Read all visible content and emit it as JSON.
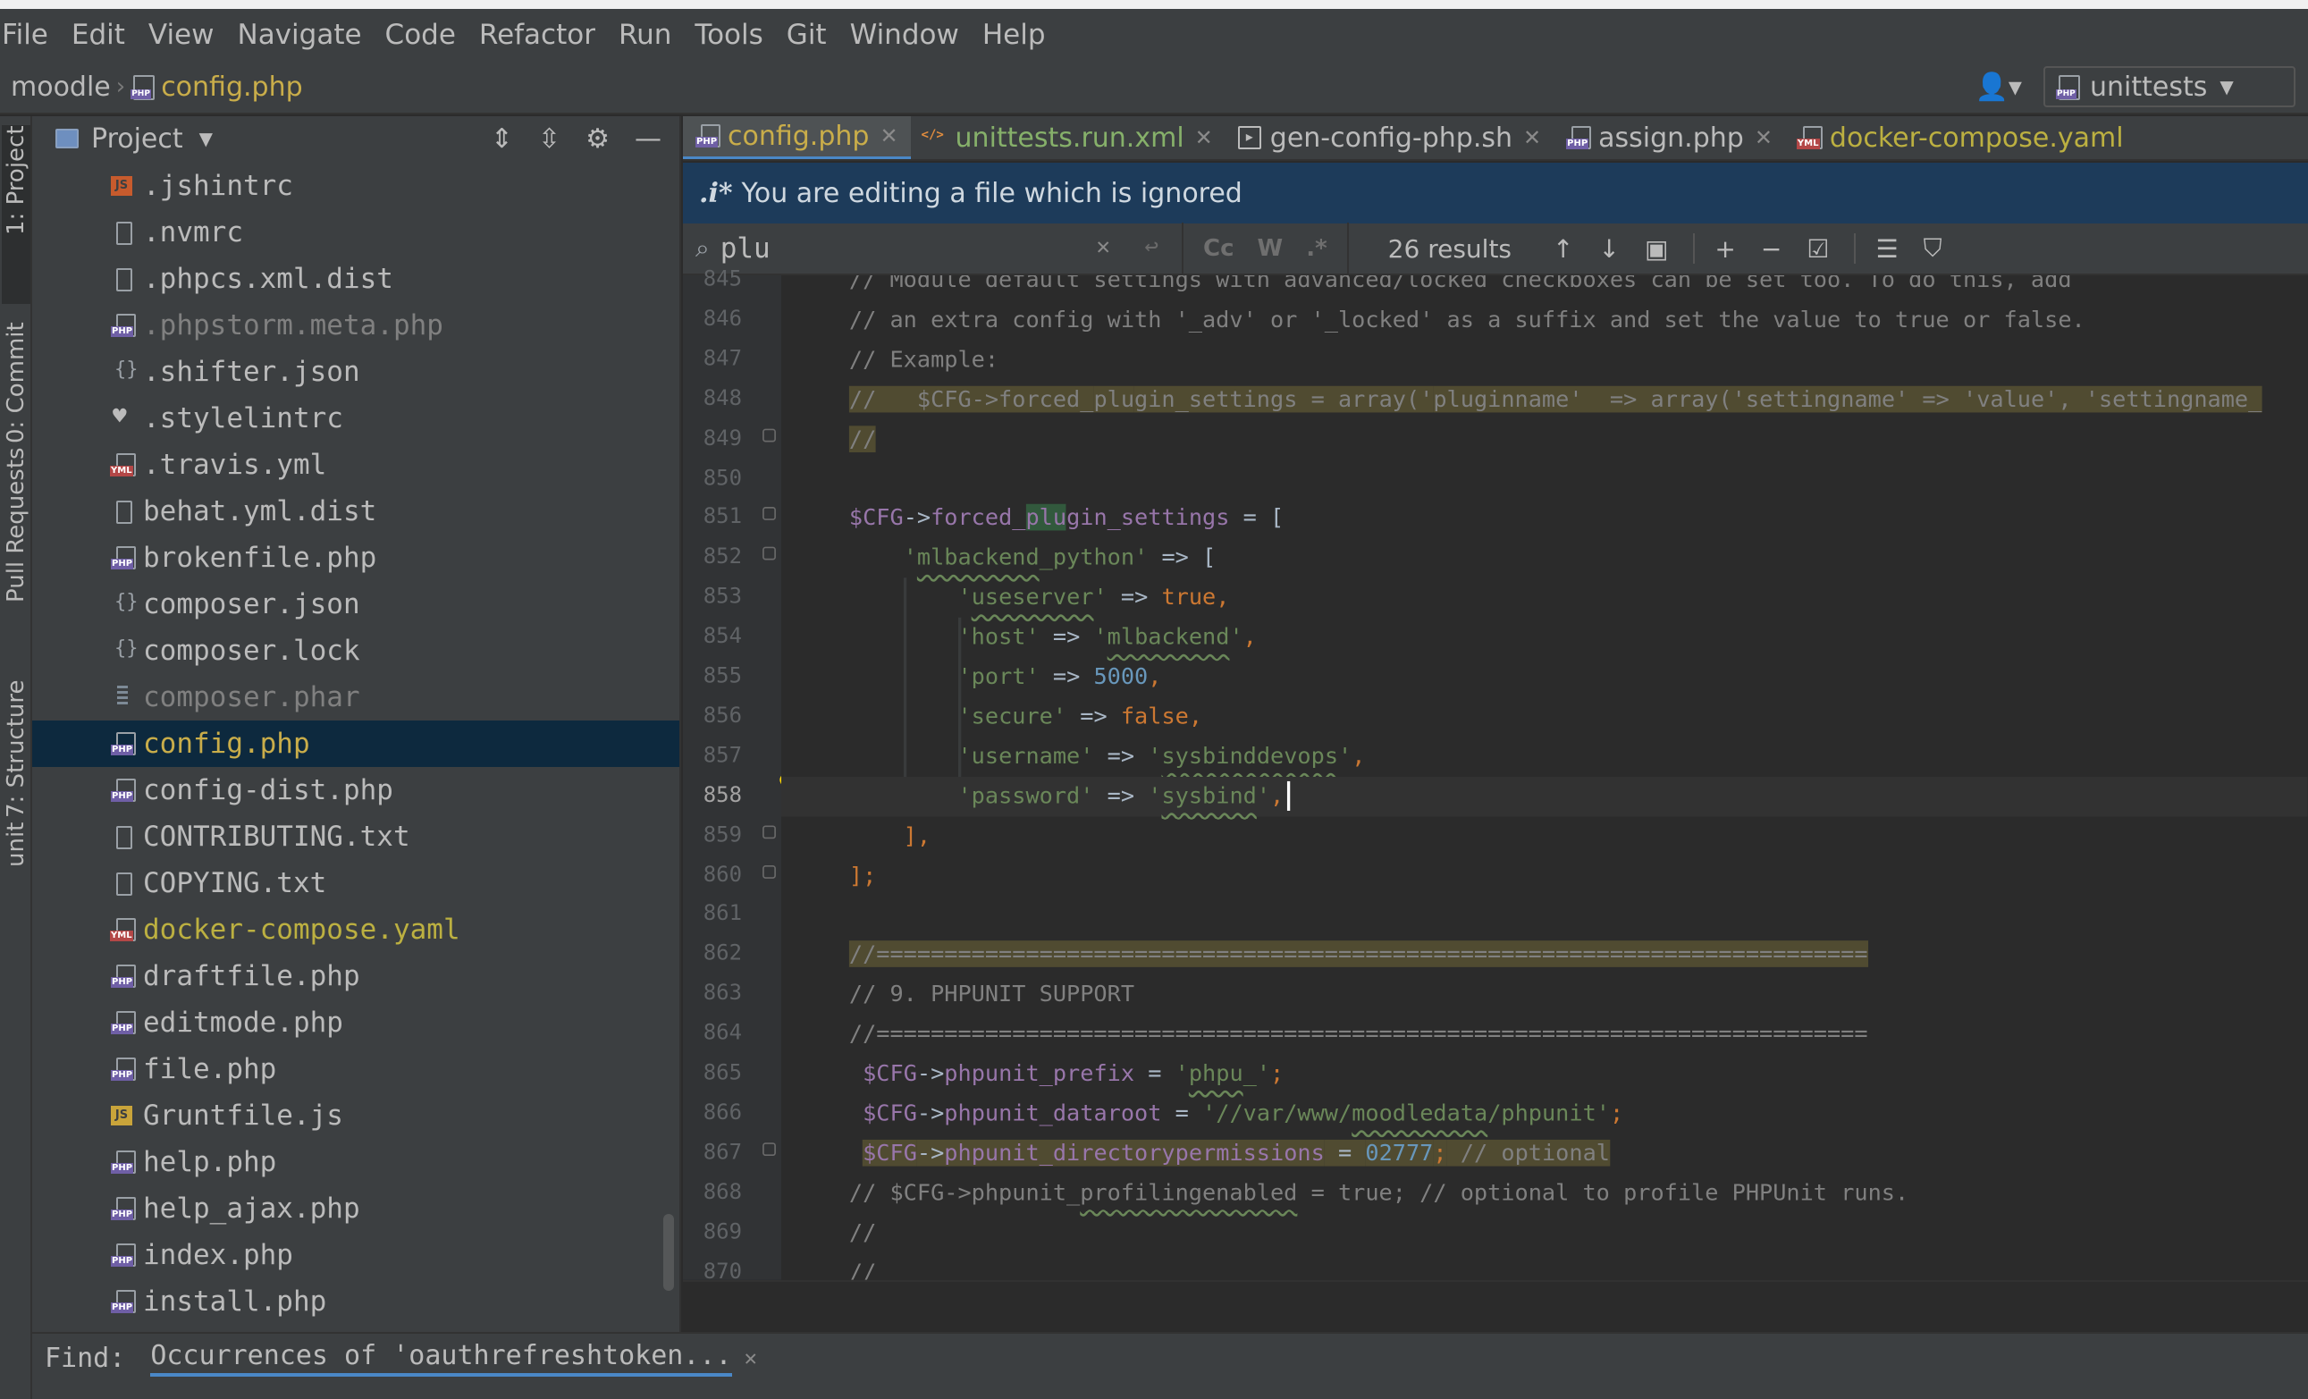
{
  "menu": [
    "File",
    "Edit",
    "View",
    "Navigate",
    "Code",
    "Refactor",
    "Run",
    "Tools",
    "Git",
    "Window",
    "Help"
  ],
  "breadcrumb": {
    "root": "moodle",
    "file": "config.php"
  },
  "run_config": {
    "label": "unittests"
  },
  "tool_windows": {
    "project": "1: Project",
    "commit": "0: Commit",
    "pull_requests": "Pull Requests",
    "structure": "7: Structure",
    "bottom": "unit"
  },
  "project_panel": {
    "title": "Project",
    "files": [
      {
        "name": ".jshintrc",
        "icon": "js-icon",
        "style": "normal"
      },
      {
        "name": ".nvmrc",
        "icon": "text-file-icon",
        "style": "normal"
      },
      {
        "name": ".phpcs.xml.dist",
        "icon": "text-file-icon",
        "style": "normal"
      },
      {
        "name": ".phpstorm.meta.php",
        "icon": "php-file-icon",
        "style": "dim"
      },
      {
        "name": ".shifter.json",
        "icon": "json-file-icon",
        "style": "normal"
      },
      {
        "name": ".stylelintrc",
        "icon": "stylelint-icon",
        "style": "normal"
      },
      {
        "name": ".travis.yml",
        "icon": "yml-file-icon",
        "style": "normal"
      },
      {
        "name": "behat.yml.dist",
        "icon": "text-file-icon",
        "style": "normal"
      },
      {
        "name": "brokenfile.php",
        "icon": "php-file-icon",
        "style": "normal"
      },
      {
        "name": "composer.json",
        "icon": "json-file-icon",
        "style": "normal"
      },
      {
        "name": "composer.lock",
        "icon": "json-file-icon",
        "style": "normal"
      },
      {
        "name": "composer.phar",
        "icon": "archive-file-icon",
        "style": "dim"
      },
      {
        "name": "config.php",
        "icon": "php-file-icon",
        "style": "selected"
      },
      {
        "name": "config-dist.php",
        "icon": "php-file-icon",
        "style": "normal"
      },
      {
        "name": "CONTRIBUTING.txt",
        "icon": "text-file-icon",
        "style": "normal"
      },
      {
        "name": "COPYING.txt",
        "icon": "text-file-icon",
        "style": "normal"
      },
      {
        "name": "docker-compose.yaml",
        "icon": "yml-file-icon",
        "style": "yaml"
      },
      {
        "name": "draftfile.php",
        "icon": "php-file-icon",
        "style": "normal"
      },
      {
        "name": "editmode.php",
        "icon": "php-file-icon",
        "style": "normal"
      },
      {
        "name": "file.php",
        "icon": "php-file-icon",
        "style": "normal"
      },
      {
        "name": "Gruntfile.js",
        "icon": "js-yellow-icon",
        "style": "normal"
      },
      {
        "name": "help.php",
        "icon": "php-file-icon",
        "style": "normal"
      },
      {
        "name": "help_ajax.php",
        "icon": "php-file-icon",
        "style": "normal"
      },
      {
        "name": "index.php",
        "icon": "php-file-icon",
        "style": "normal"
      },
      {
        "name": "install.php",
        "icon": "php-file-icon",
        "style": "normal"
      }
    ]
  },
  "editor_tabs": [
    {
      "label": "config.php",
      "icon": "php",
      "state": "active"
    },
    {
      "label": "unittests.run.xml",
      "icon": "xml",
      "state": "green"
    },
    {
      "label": "gen-config-php.sh",
      "icon": "sh",
      "state": "normal"
    },
    {
      "label": "assign.php",
      "icon": "php",
      "state": "normal"
    },
    {
      "label": "docker-compose.yaml",
      "icon": "yml",
      "state": "yaml"
    }
  ],
  "banner": {
    "icon_text": ".i*",
    "text": "You are editing a file which is ignored"
  },
  "find": {
    "query": "plu",
    "options": [
      "Cc",
      "W",
      ".*"
    ],
    "results": "26 results"
  },
  "code": {
    "current_line": 858,
    "lines": [
      {
        "n": 845,
        "tokens": [
          {
            "t": "// Module default settings with advanced/locked checkboxes can be set too. To do this, add",
            "c": "com"
          }
        ]
      },
      {
        "n": 846,
        "tokens": [
          {
            "t": "// an extra config with '_adv' or '_locked' as a suffix and set the value to true or false.",
            "c": "com"
          }
        ]
      },
      {
        "n": 847,
        "tokens": [
          {
            "t": "// Example:",
            "c": "com"
          }
        ]
      },
      {
        "n": 848,
        "line_hl": true,
        "tokens": [
          {
            "t": "//   $CFG->forced_",
            "c": "com"
          },
          {
            "t": "plu",
            "c": "com",
            "m": true
          },
          {
            "t": "gin_settings = array('",
            "c": "com"
          },
          {
            "t": "plu",
            "c": "com",
            "m": true
          },
          {
            "t": "ginname'  => array('settingname' => 'value', 'settingname_",
            "c": "com"
          }
        ]
      },
      {
        "n": 849,
        "line_hl": true,
        "tokens": [
          {
            "t": "//",
            "c": "com"
          }
        ]
      },
      {
        "n": 850,
        "tokens": []
      },
      {
        "n": 851,
        "tokens": [
          {
            "t": "$CFG",
            "c": "var"
          },
          {
            "t": "->",
            "c": ""
          },
          {
            "t": "forced_",
            "c": "var"
          },
          {
            "t": "plu",
            "c": "var",
            "m": true
          },
          {
            "t": "gin_settings",
            "c": "var"
          },
          {
            "t": " = [",
            "c": ""
          }
        ]
      },
      {
        "n": 852,
        "tokens": [
          {
            "t": "    ",
            "c": ""
          },
          {
            "t": "'",
            "c": "str"
          },
          {
            "t": "mlbackend",
            "c": "str",
            "w": true
          },
          {
            "t": "_python'",
            "c": "str"
          },
          {
            "t": " => [",
            "c": ""
          }
        ]
      },
      {
        "n": 853,
        "tokens": [
          {
            "t": "        ",
            "c": ""
          },
          {
            "t": "'",
            "c": "str"
          },
          {
            "t": "useserver",
            "c": "str",
            "w": true
          },
          {
            "t": "'",
            "c": "str"
          },
          {
            "t": " => ",
            "c": ""
          },
          {
            "t": "true",
            "c": "kw"
          },
          {
            "t": ",",
            "c": "kw"
          }
        ]
      },
      {
        "n": 854,
        "tokens": [
          {
            "t": "        ",
            "c": ""
          },
          {
            "t": "'host'",
            "c": "str"
          },
          {
            "t": " => ",
            "c": ""
          },
          {
            "t": "'",
            "c": "str"
          },
          {
            "t": "mlbackend",
            "c": "str",
            "w": true
          },
          {
            "t": "'",
            "c": "str"
          },
          {
            "t": ",",
            "c": "kw"
          }
        ]
      },
      {
        "n": 855,
        "tokens": [
          {
            "t": "        ",
            "c": ""
          },
          {
            "t": "'port'",
            "c": "str"
          },
          {
            "t": " => ",
            "c": ""
          },
          {
            "t": "5000",
            "c": "num"
          },
          {
            "t": ",",
            "c": "kw"
          }
        ]
      },
      {
        "n": 856,
        "tokens": [
          {
            "t": "        ",
            "c": ""
          },
          {
            "t": "'secure'",
            "c": "str"
          },
          {
            "t": " => ",
            "c": ""
          },
          {
            "t": "false",
            "c": "kw"
          },
          {
            "t": ",",
            "c": "kw"
          }
        ]
      },
      {
        "n": 857,
        "tokens": [
          {
            "t": "        ",
            "c": ""
          },
          {
            "t": "'username'",
            "c": "str"
          },
          {
            "t": " => ",
            "c": ""
          },
          {
            "t": "'",
            "c": "str"
          },
          {
            "t": "sysbinddevops",
            "c": "str",
            "w": true
          },
          {
            "t": "'",
            "c": "str"
          },
          {
            "t": ",",
            "c": "kw"
          }
        ]
      },
      {
        "n": 858,
        "tokens": [
          {
            "t": "        ",
            "c": ""
          },
          {
            "t": "'password'",
            "c": "str"
          },
          {
            "t": " => ",
            "c": ""
          },
          {
            "t": "'",
            "c": "str"
          },
          {
            "t": "sysbind",
            "c": "str",
            "w": true
          },
          {
            "t": "'",
            "c": "str"
          },
          {
            "t": ",",
            "c": "kw"
          }
        ]
      },
      {
        "n": 859,
        "tokens": [
          {
            "t": "    ],",
            "c": "kw"
          }
        ]
      },
      {
        "n": 860,
        "tokens": [
          {
            "t": "];",
            "c": "kw"
          }
        ]
      },
      {
        "n": 861,
        "tokens": []
      },
      {
        "n": 862,
        "tokens": [
          {
            "t": "//=========================================================================",
            "c": "com",
            "h": true
          }
        ]
      },
      {
        "n": 863,
        "tokens": [
          {
            "t": "// 9. PHPUNIT SUPPORT",
            "c": "com"
          }
        ]
      },
      {
        "n": 864,
        "tokens": [
          {
            "t": "//=========================================================================",
            "c": "com"
          }
        ]
      },
      {
        "n": 865,
        "tokens": [
          {
            "t": " ",
            "c": ""
          },
          {
            "t": "$CFG",
            "c": "var"
          },
          {
            "t": "->",
            "c": ""
          },
          {
            "t": "phpunit_prefix",
            "c": "var"
          },
          {
            "t": " = ",
            "c": ""
          },
          {
            "t": "'",
            "c": "str"
          },
          {
            "t": "phpu",
            "c": "str",
            "w": true
          },
          {
            "t": "_'",
            "c": "str"
          },
          {
            "t": ";",
            "c": "kw"
          }
        ]
      },
      {
        "n": 866,
        "tokens": [
          {
            "t": " ",
            "c": ""
          },
          {
            "t": "$CFG",
            "c": "var"
          },
          {
            "t": "->",
            "c": ""
          },
          {
            "t": "phpunit_dataroot",
            "c": "var"
          },
          {
            "t": " = ",
            "c": ""
          },
          {
            "t": "'//var/www/",
            "c": "str"
          },
          {
            "t": "moodledata",
            "c": "str",
            "w": true
          },
          {
            "t": "/phpunit'",
            "c": "str"
          },
          {
            "t": ";",
            "c": "kw"
          }
        ]
      },
      {
        "n": 867,
        "tokens": [
          {
            "t": " ",
            "c": ""
          },
          {
            "t": "$CFG",
            "c": "var",
            "h": true
          },
          {
            "t": "->",
            "c": "",
            "h": true
          },
          {
            "t": "phpunit_directorypermissions",
            "c": "var",
            "h": true
          },
          {
            "t": " = ",
            "c": "",
            "h": true
          },
          {
            "t": "02777",
            "c": "num",
            "h": true
          },
          {
            "t": ";",
            "c": "kw",
            "h": true
          },
          {
            "t": " // optional",
            "c": "com",
            "h": true
          }
        ]
      },
      {
        "n": 868,
        "tokens": [
          {
            "t": "// $CFG->phpunit_",
            "c": "com"
          },
          {
            "t": "profilingenabled",
            "c": "com",
            "w": true
          },
          {
            "t": " = true; // optional to profile PHPUnit runs.",
            "c": "com"
          }
        ]
      },
      {
        "n": 869,
        "tokens": [
          {
            "t": "//",
            "c": "com"
          }
        ]
      },
      {
        "n": 870,
        "tokens": [
          {
            "t": "//",
            "c": "com"
          }
        ]
      }
    ]
  },
  "find_tool": {
    "label": "Find:",
    "tab": "Occurrences of 'oauthrefreshtoken..."
  }
}
